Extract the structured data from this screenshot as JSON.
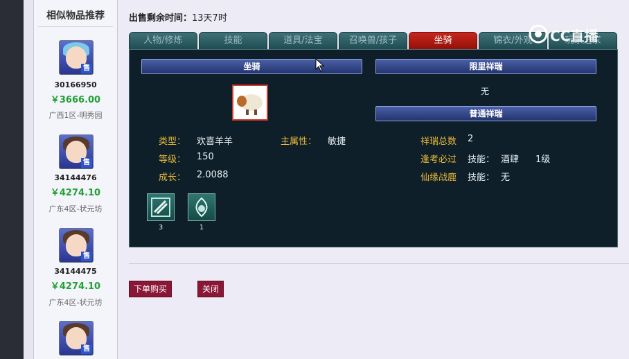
{
  "sidebar": {
    "title": "相似物品推荐",
    "items": [
      {
        "id": "30166950",
        "price": "￥3666.00",
        "server": "广西1区-明秀园",
        "badge": "售"
      },
      {
        "id": "34144476",
        "price": "￥4274.10",
        "server": "广东4区-状元坊",
        "badge": "售"
      },
      {
        "id": "34144475",
        "price": "￥4274.10",
        "server": "广东4区-状元坊",
        "badge": "售"
      },
      {
        "badge": "售"
      }
    ]
  },
  "header": {
    "remain_label": "出售剩余时间：",
    "remain_value": "13天7时"
  },
  "tabs": [
    {
      "label": "人物/修炼"
    },
    {
      "label": "技能"
    },
    {
      "label": "道具/法宝"
    },
    {
      "label": "召唤兽/孩子"
    },
    {
      "label": "坐骑"
    },
    {
      "label": "锦衣/外观"
    },
    {
      "label": "玩家之家"
    }
  ],
  "panel": {
    "mount_header": "坐骑",
    "limited_header": "限里祥瑞",
    "limited_value": "无",
    "normal_header": "普通祥瑞",
    "type_label": "类型：",
    "type_value": "欢喜羊羊",
    "attr_label": "主属性：",
    "attr_value": "敏捷",
    "level_label": "等级：",
    "level_value": "150",
    "growth_label": "成长：",
    "growth_value": "2.0088",
    "xr_total_label": "祥瑞总数",
    "xr_total_value": "2",
    "xr1_name": "逢考必过",
    "xr1_skill": "技能：",
    "xr1_skill_name": "酒肆",
    "xr1_skill_level": "1级",
    "xr2_name": "仙缘战鹿",
    "xr2_skill": "技能：",
    "xr2_skill_value": "无",
    "skills": [
      {
        "count": "3"
      },
      {
        "count": "1"
      }
    ]
  },
  "buttons": {
    "buy": "下单购买",
    "close": "关闭"
  },
  "watermark": "CC直播",
  "colors": {
    "accent_red": "#c8271c",
    "price_green": "#22a035",
    "label_gold": "#e7b839",
    "button_crimson": "#8a1736"
  }
}
